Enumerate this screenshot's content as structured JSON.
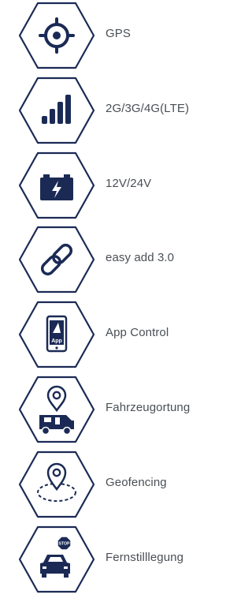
{
  "colors": {
    "navy": "#1b2a55",
    "text": "#4a4f55",
    "background": "#ffffff"
  },
  "features": [
    {
      "icon": "gps-crosshair-icon",
      "label": "GPS"
    },
    {
      "icon": "signal-bars-icon",
      "label": "2G/3G/4G(LTE)"
    },
    {
      "icon": "battery-icon",
      "label": "12V/24V"
    },
    {
      "icon": "chain-link-icon",
      "label": "easy add 3.0"
    },
    {
      "icon": "smartphone-app-icon",
      "label": "App Control",
      "icon_text": "App"
    },
    {
      "icon": "map-pin-camper-icon",
      "label": "Fahrzeugortung"
    },
    {
      "icon": "geofence-pin-icon",
      "label": "Geofencing"
    },
    {
      "icon": "stop-car-icon",
      "label": "Fernstilllegung",
      "icon_text": "STOP"
    }
  ]
}
